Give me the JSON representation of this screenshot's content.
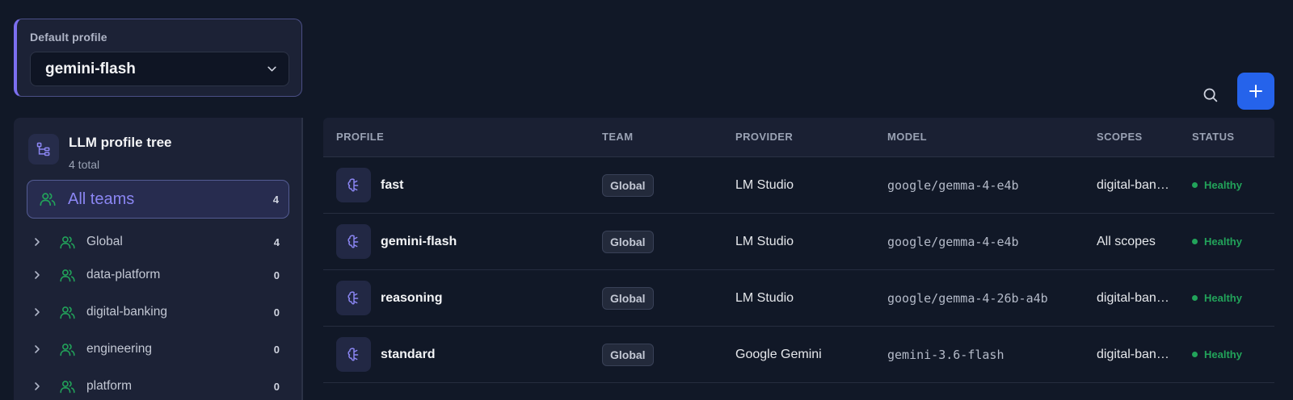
{
  "default_profile": {
    "label": "Default profile",
    "selected": "gemini-flash"
  },
  "toolbar": {
    "search_icon": "search-icon",
    "add_icon": "plus-icon"
  },
  "tree": {
    "title": "LLM profile tree",
    "subtitle": "4 total",
    "all_teams": {
      "label": "All teams",
      "count": "4"
    },
    "teams": [
      {
        "name": "Global",
        "count": "4"
      },
      {
        "name": "data-platform",
        "count": "0"
      },
      {
        "name": "digital-banking",
        "count": "0"
      },
      {
        "name": "engineering",
        "count": "0"
      },
      {
        "name": "platform",
        "count": "0"
      }
    ]
  },
  "table": {
    "headers": {
      "profile": "PROFILE",
      "team": "TEAM",
      "provider": "PROVIDER",
      "model": "MODEL",
      "scopes": "SCOPES",
      "status": "STATUS"
    },
    "rows": [
      {
        "name": "fast",
        "team": "Global",
        "provider": "LM Studio",
        "model": "google/gemma-4-e4b",
        "scopes": "digital-banking",
        "status": "Healthy"
      },
      {
        "name": "gemini-flash",
        "team": "Global",
        "provider": "LM Studio",
        "model": "google/gemma-4-e4b",
        "scopes": "All scopes",
        "status": "Healthy"
      },
      {
        "name": "reasoning",
        "team": "Global",
        "provider": "LM Studio",
        "model": "google/gemma-4-26b-a4b",
        "scopes": "digital-banking",
        "status": "Healthy"
      },
      {
        "name": "standard",
        "team": "Global",
        "provider": "Google Gemini",
        "model": "gemini-3.6-flash",
        "scopes": "digital-banking",
        "status": "Healthy"
      }
    ]
  },
  "colors": {
    "accent": "#7c6ff0",
    "primary_button": "#2563eb",
    "team_icon": "#22a35a",
    "healthy": "#22a35a"
  }
}
